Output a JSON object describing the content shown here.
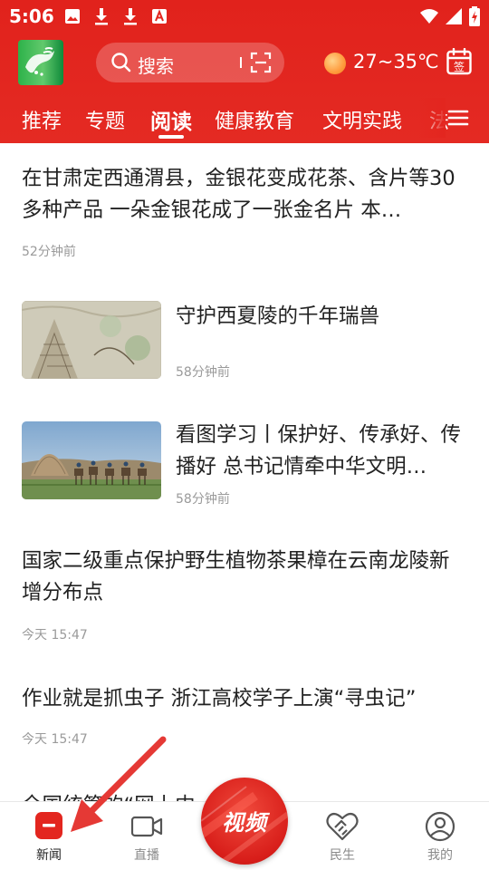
{
  "status_bar": {
    "time": "5:06",
    "icons": [
      "image-icon",
      "download-icon",
      "download-icon",
      "text-a-icon"
    ],
    "right_icons": [
      "wifi-icon",
      "signal-icon",
      "battery-charging-icon"
    ]
  },
  "header": {
    "search_placeholder": "搜索",
    "weather": "27~35℃",
    "calendar_label": "签"
  },
  "tabs": [
    {
      "label": "推荐"
    },
    {
      "label": "专题"
    },
    {
      "label": "阅读"
    },
    {
      "label": "健康教育"
    },
    {
      "label": "文明实践"
    },
    {
      "label": "法"
    }
  ],
  "active_tab": "阅读",
  "feed": [
    {
      "title": "在甘肃定西通渭县，金银花变成花茶、含片等30多种产品 一朵金银花成了一张金名片 本…",
      "time": "52分钟前"
    },
    {
      "title": "守护西夏陵的千年瑞兽",
      "time": "58分钟前"
    },
    {
      "title": "看图学习丨保护好、传承好、传播好 总书记情牵中华文明…",
      "time": "58分钟前"
    },
    {
      "title": "国家二级重点保护野生植物茶果樟在云南龙陵新增分布点",
      "time": "今天 15:47"
    },
    {
      "title": "作业就是抓虫子 浙江高校学子上演“寻虫记”",
      "time": "今天 15:47"
    },
    {
      "title": "全国统筹的“网上中…",
      "time": ""
    }
  ],
  "bottom_nav": {
    "items": [
      {
        "label": "新闻"
      },
      {
        "label": "直播"
      },
      {
        "label": "民生"
      },
      {
        "label": "我的"
      }
    ],
    "video_label": "视频",
    "active": "新闻"
  },
  "colors": {
    "brand_red": "#e3261f",
    "text_primary": "#222222",
    "text_meta": "#9a9a9a",
    "arrow_red": "#e53935"
  }
}
